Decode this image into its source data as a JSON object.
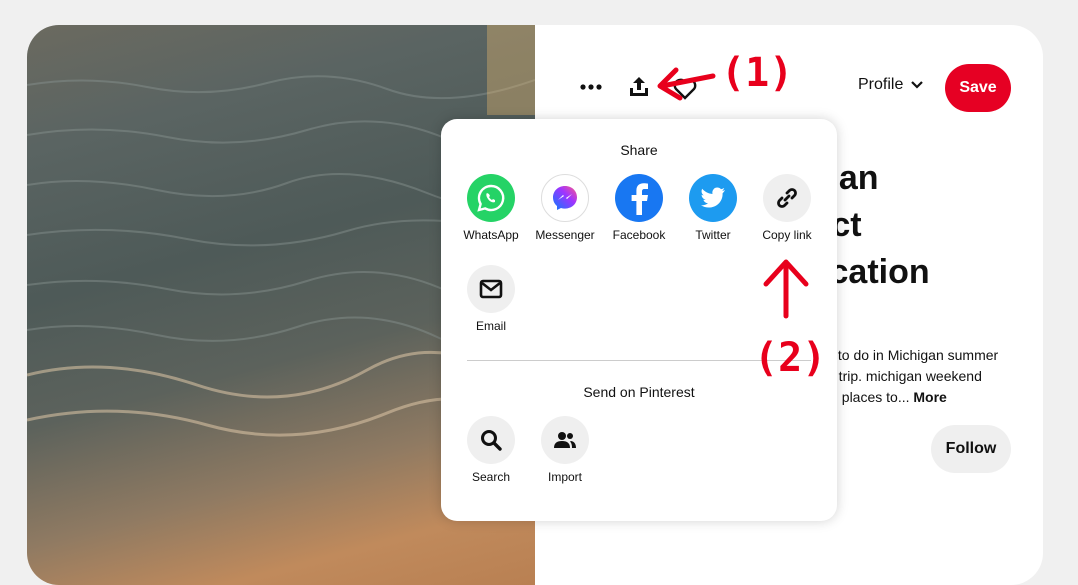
{
  "toolbar": {
    "more_icon": "ellipsis-icon",
    "share_icon": "upload-share-icon",
    "heart_icon": "heart-icon"
  },
  "profile": {
    "label": "Profile"
  },
  "save": {
    "label": "Save",
    "color": "#e60023"
  },
  "pin": {
    "title": "chigan\nerfect\nr vacation",
    "desc_line1": "s to do in Michigan summer",
    "desc_line2": "d trip. michigan weekend",
    "desc_line3": "ul places to... ",
    "more": "More"
  },
  "follow": {
    "label": "Follow"
  },
  "share_popup": {
    "title": "Share",
    "apps": [
      {
        "label": "WhatsApp",
        "icon": "whatsapp-icon",
        "color": "#25d366"
      },
      {
        "label": "Messenger",
        "icon": "messenger-icon",
        "color": "#ffffff"
      },
      {
        "label": "Facebook",
        "icon": "facebook-icon",
        "color": "#1877f2"
      },
      {
        "label": "Twitter",
        "icon": "twitter-icon",
        "color": "#1d9bf0"
      },
      {
        "label": "Copy link",
        "icon": "link-icon",
        "color": "#efefef"
      },
      {
        "label": "Email",
        "icon": "email-icon",
        "color": "#efefef"
      }
    ],
    "send_title": "Send on Pinterest",
    "send_items": [
      {
        "label": "Search",
        "icon": "search-icon"
      },
      {
        "label": "Import",
        "icon": "contacts-icon"
      }
    ]
  },
  "annotations": {
    "step1": "(1)",
    "step2": "(2)"
  }
}
